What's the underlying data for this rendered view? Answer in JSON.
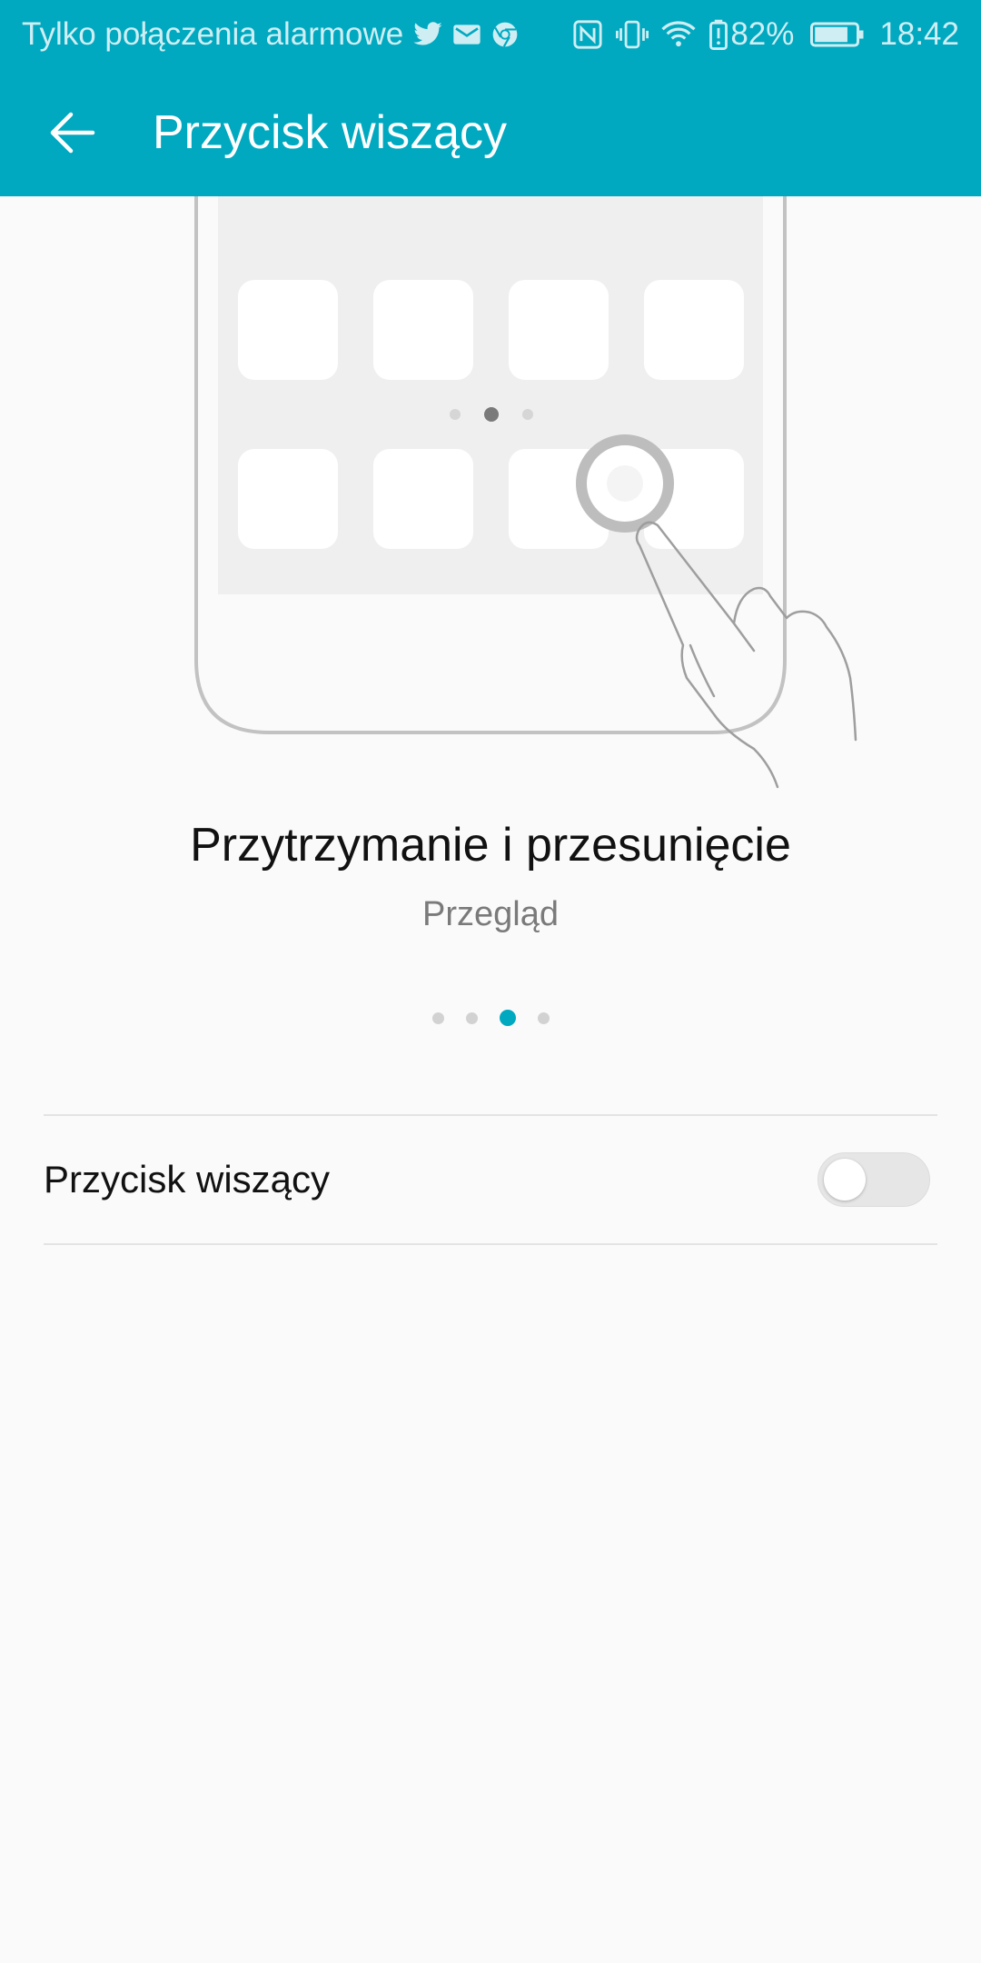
{
  "status_bar": {
    "carrier_text": "Tylko połączenia alarmowe",
    "notification_icons": [
      "twitter-icon",
      "mail-icon",
      "chrome-icon"
    ],
    "system_icons": [
      "nfc-icon",
      "vibrate-icon",
      "wifi-icon",
      "battery-alert-icon"
    ],
    "battery_percent": "82%",
    "battery_level": 0.82,
    "time": "18:42"
  },
  "toolbar": {
    "back_icon": "back-arrow-icon",
    "title": "Przycisk wiszący"
  },
  "tutorial": {
    "heading": "Przytrzymanie i przesunięcie",
    "subheading": "Przegląd",
    "illustration_icons": [
      "phone-outline-icon",
      "app-grid-icon",
      "floating-button-icon",
      "finger-icon"
    ],
    "illustration_page_dots": 3,
    "illustration_active_dot": 2,
    "page_count": 4,
    "active_page": 3
  },
  "settings": {
    "floating_button": {
      "label": "Przycisk wiszący",
      "enabled": false
    }
  },
  "colors": {
    "accent": "#00a9c0",
    "background": "#fafafa",
    "toggle_off": "#e6e6e6"
  }
}
